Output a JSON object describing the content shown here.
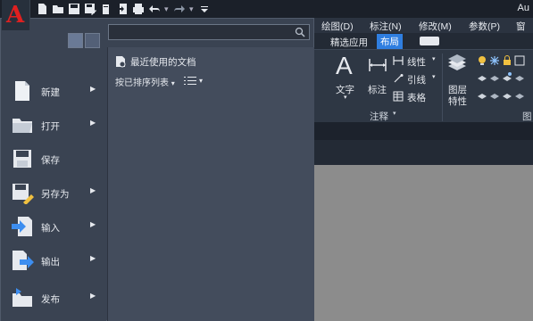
{
  "titlebar": {
    "title": "Au",
    "qat_icons": [
      "new-file-icon",
      "open-folder-icon",
      "save-icon",
      "save-as-icon",
      "publish-icon",
      "import-icon",
      "print-icon",
      "undo-icon",
      "redo-icon",
      "customize-dropdown-icon"
    ]
  },
  "ribbon_tabs": [
    "绘图(D)",
    "标注(N)",
    "修改(M)",
    "参数(P)",
    "窗口"
  ],
  "ribbon_subtabs": {
    "select": "精选应用",
    "layout": "布局"
  },
  "ribbon_panel": {
    "text_button": "文字",
    "dimension_button": "标注",
    "linear": "线性",
    "leader": "引线",
    "table": "表格",
    "annotation_panel": "注释",
    "layer_props_line1": "图层",
    "layer_props_line2": "特性",
    "layers_panel": "图"
  },
  "appmenu": {
    "search": {
      "placeholder": "",
      "value": ""
    },
    "items": [
      {
        "label": "新建",
        "icon": "new-file-icon",
        "has_submenu": true
      },
      {
        "label": "打开",
        "icon": "open-folder-icon",
        "has_submenu": true
      },
      {
        "label": "保存",
        "icon": "save-icon",
        "has_submenu": false
      },
      {
        "label": "另存为",
        "icon": "save-as-icon",
        "has_submenu": true
      },
      {
        "label": "输入",
        "icon": "import-icon",
        "has_submenu": true
      },
      {
        "label": "输出",
        "icon": "export-icon",
        "has_submenu": true
      },
      {
        "label": "发布",
        "icon": "publish-icon",
        "has_submenu": true
      }
    ],
    "recent": {
      "heading": "最近使用的文档",
      "sort_label": "按已排序列表",
      "sort_arrow": "▾",
      "view_arrow": "▾"
    }
  },
  "colors": {
    "accent": "#2f7ee0",
    "brand_red": "#e02020",
    "menu_bg": "#3a4352",
    "canvas_bg": "#8c8c8c"
  }
}
